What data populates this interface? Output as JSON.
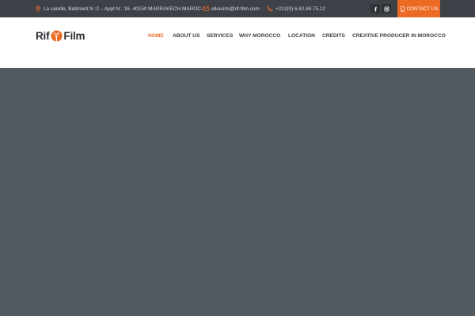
{
  "topbar": {
    "address": "La carelle, Batiment N :2 – Appt N : 16- 40150 MARRAKECH-MAROC-",
    "email": "elkacimi@rif-film.com",
    "phone": "+212(0) 6.62.84.75.12",
    "contact_button": "CONTACT US",
    "colors": {
      "bar": "#3e4248",
      "accent": "#ec6a24",
      "icon": "#ec6a24"
    }
  },
  "social": [
    {
      "icon": "facebook-icon"
    },
    {
      "icon": "instagram-icon"
    }
  ],
  "header": {
    "logo_left": "Rif",
    "logo_right": "Film"
  },
  "nav": {
    "items": [
      {
        "label": "HOME",
        "active": true
      },
      {
        "label": "ABOUT US"
      },
      {
        "label": "SERVICES"
      },
      {
        "label": "WHY MOROCCO"
      },
      {
        "label": "LOCATION"
      },
      {
        "label": "CREDITS"
      },
      {
        "label": "CREATIVE PRODUCER IN MOROCCO"
      }
    ],
    "active_color": "#ec6a24"
  },
  "hero": {
    "background": "#525960"
  }
}
